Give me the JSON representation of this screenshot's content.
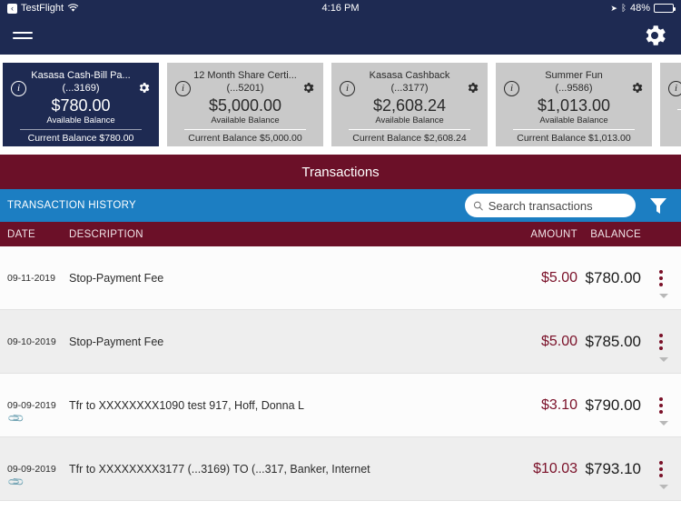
{
  "status_bar": {
    "back_glyph": "‹",
    "app_name": "TestFlight",
    "wifi_icon": "wifi-icon",
    "time": "4:16 PM",
    "location_glyph": "➤",
    "bluetooth_glyph": "ᛒ",
    "battery_percent": "48%"
  },
  "nav_bar": {
    "menu_icon": "hamburger-menu-icon",
    "settings_icon": "gear-icon"
  },
  "accounts": [
    {
      "name": "Kasasa Cash-Bill Pa...",
      "number": "(...3169)",
      "available_balance": "$780.00",
      "available_label": "Available Balance",
      "current_balance": "Current Balance $780.00",
      "selected": true
    },
    {
      "name": "12 Month Share Certi...",
      "number": "(...5201)",
      "available_balance": "$5,000.00",
      "available_label": "Available Balance",
      "current_balance": "Current Balance $5,000.00",
      "selected": false
    },
    {
      "name": "Kasasa Cashback",
      "number": "(...3177)",
      "available_balance": "$2,608.24",
      "available_label": "Available Balance",
      "current_balance": "Current Balance $2,608.24",
      "selected": false
    },
    {
      "name": "Summer Fun",
      "number": "(...9586)",
      "available_balance": "$1,013.00",
      "available_label": "Available Balance",
      "current_balance": "Current Balance $1,013.00",
      "selected": false
    }
  ],
  "transactions_panel": {
    "title": "Transactions",
    "history_label": "TRANSACTION HISTORY",
    "search_placeholder": "Search transactions",
    "search_value": "",
    "search_icon": "search-icon",
    "filter_icon": "filter-funnel-icon",
    "columns": {
      "date": "DATE",
      "description": "DESCRIPTION",
      "amount": "AMOUNT",
      "balance": "BALANCE"
    },
    "rows": [
      {
        "date": "09-11-2019",
        "description": "Stop-Payment Fee",
        "amount": "$5.00",
        "balance": "$780.00",
        "has_attachment": false
      },
      {
        "date": "09-10-2019",
        "description": "Stop-Payment Fee",
        "amount": "$5.00",
        "balance": "$785.00",
        "has_attachment": false
      },
      {
        "date": "09-09-2019",
        "description": "Tfr to XXXXXXXX1090 test 917, Hoff, Donna L",
        "amount": "$3.10",
        "balance": "$790.00",
        "has_attachment": true
      },
      {
        "date": "09-09-2019",
        "description": "Tfr to XXXXXXXX3177 (...3169) TO (...317, Banker, Internet",
        "amount": "$10.03",
        "balance": "$793.10",
        "has_attachment": true
      }
    ]
  },
  "colors": {
    "navy": "#1e2a52",
    "maroon": "#6b1028",
    "blue": "#1c7ec2",
    "amount_red": "#7a1028",
    "card_gray": "#c9c9c9"
  }
}
